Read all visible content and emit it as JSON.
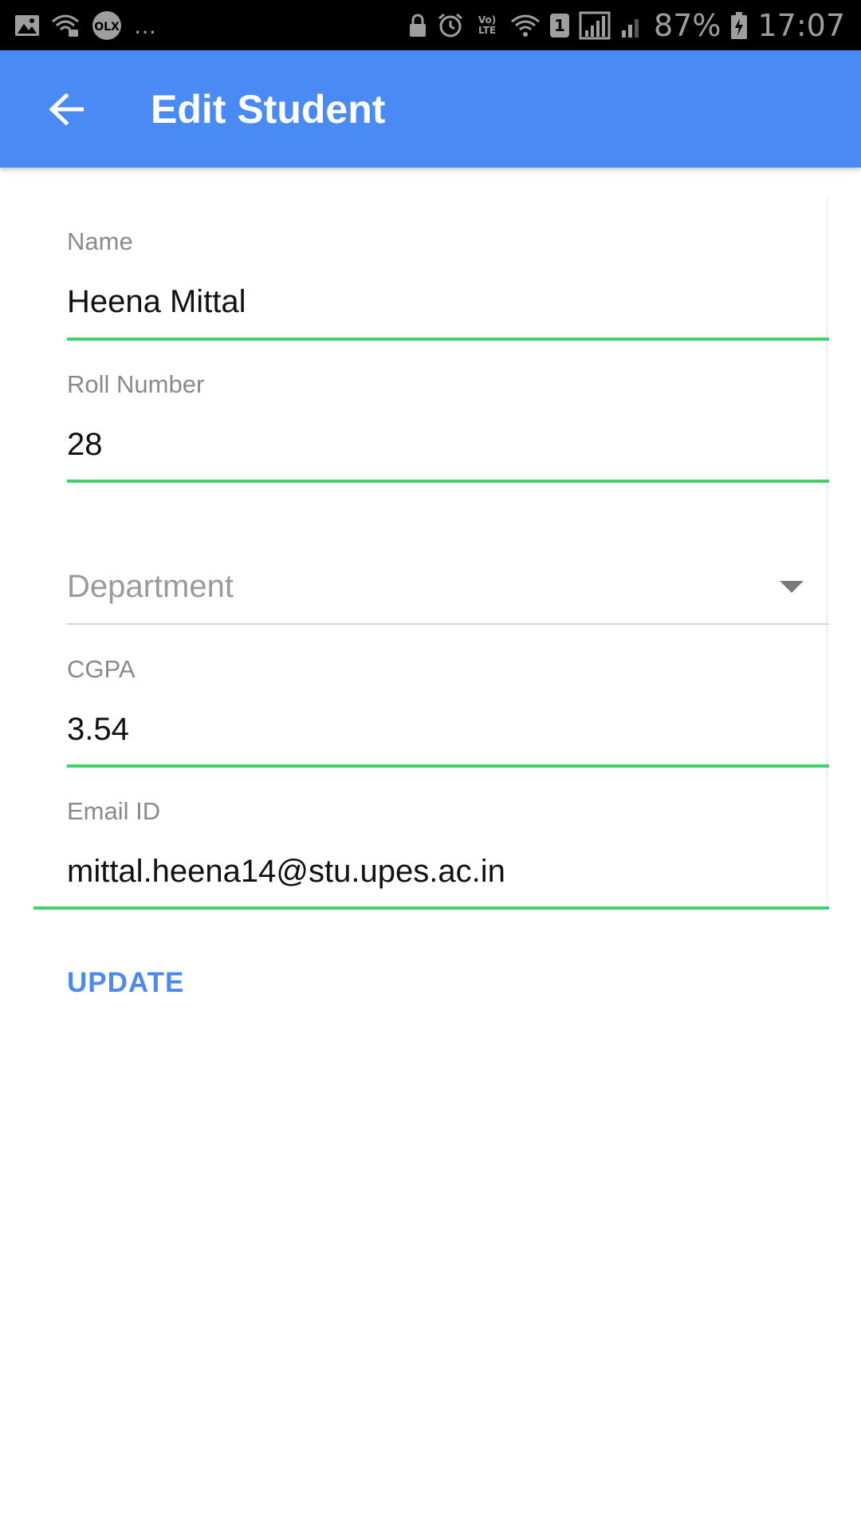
{
  "status_bar": {
    "more_indicator": "…",
    "network_label": "Vo) LTE",
    "sim_slot": "1",
    "battery_percent": "87%",
    "time": "17:07",
    "icons": [
      "gallery-icon",
      "wifi-lock-icon",
      "olx-icon",
      "lock-icon",
      "alarm-icon",
      "volte-icon",
      "wifi-icon",
      "sim-icon",
      "signal-icon",
      "signal-weak-icon",
      "battery-charging-icon"
    ]
  },
  "app_bar": {
    "title": "Edit Student",
    "back_icon": "arrow-left-icon",
    "color": "#4a8af4"
  },
  "form": {
    "name": {
      "label": "Name",
      "value": "Heena Mittal"
    },
    "roll_number": {
      "label": "Roll Number",
      "value": "28"
    },
    "department": {
      "placeholder": "Department",
      "icon": "dropdown-arrow-icon"
    },
    "cgpa": {
      "label": "CGPA",
      "value": "3.54"
    },
    "email": {
      "label": "Email ID",
      "value": "mittal.heena14@stu.upes.ac.in"
    },
    "active_underline_color": "#3fd16a"
  },
  "actions": {
    "update_label": "UPDATE"
  }
}
